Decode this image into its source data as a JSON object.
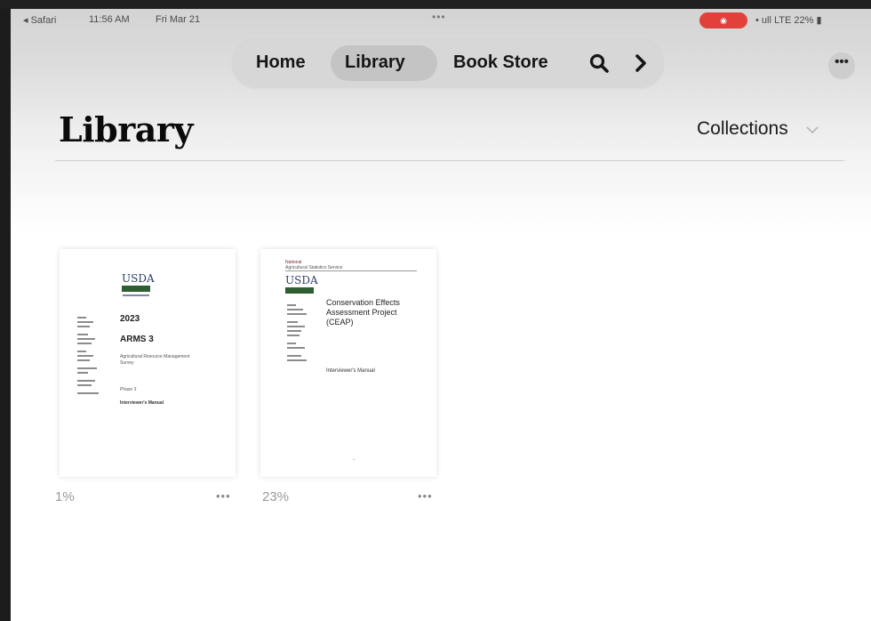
{
  "status_bar": {
    "back_app": "◂ Safari",
    "time": "11:56 AM",
    "date": "Fri Mar 21",
    "multitask_dots": "•••",
    "recording_badge": "◉",
    "connectivity": "• ull LTE 22% ▮"
  },
  "nav": {
    "home": "Home",
    "library": "Library",
    "book_store": "Book Store",
    "selected": "Library",
    "search_icon": "search-icon",
    "next_icon": "chevron-right-icon"
  },
  "header": {
    "title": "Library",
    "collections_label": "Collections",
    "more_button": "•••"
  },
  "books": [
    {
      "publisher": "USDA",
      "year": "2023",
      "title": "ARMS 3",
      "subtitle": "Agricultural Resource Management Survey",
      "phase": "Phase 3",
      "manual": "Interviewer's Manual",
      "progress": "1%",
      "more": "•••"
    },
    {
      "publisher": "USDA",
      "header_line1": "National",
      "header_line2": "Agricultural Statistics Service",
      "title": "Conservation Effects Assessment Project (CEAP)",
      "manual": "Interviewer's Manual",
      "progress": "23%",
      "more": "•••"
    }
  ],
  "colors": {
    "status_red": "#e1403b",
    "nav_pill": "#d7d7d7",
    "nav_selected": "#c4c4c4",
    "usda_blue": "#2a3c66",
    "usda_green": "#2f5e33"
  }
}
